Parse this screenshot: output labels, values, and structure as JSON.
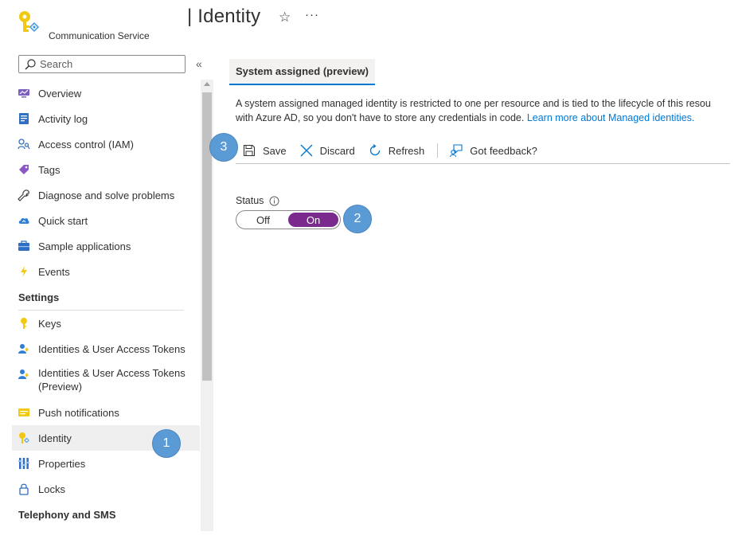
{
  "header": {
    "resource_type": "Communication Service",
    "title": "| Identity",
    "favorite_glyph": "☆",
    "more_glyph": "···"
  },
  "sidebar": {
    "search_placeholder": "Search",
    "collapse_glyph": "«",
    "items": [
      {
        "label": "Overview",
        "icon": "overview-icon"
      },
      {
        "label": "Activity log",
        "icon": "activity-log-icon"
      },
      {
        "label": "Access control (IAM)",
        "icon": "access-control-icon"
      },
      {
        "label": "Tags",
        "icon": "tag-icon"
      },
      {
        "label": "Diagnose and solve problems",
        "icon": "wrench-icon"
      },
      {
        "label": "Quick start",
        "icon": "cloud-icon"
      },
      {
        "label": "Sample applications",
        "icon": "briefcase-icon"
      },
      {
        "label": "Events",
        "icon": "lightning-icon"
      }
    ],
    "settings_heading": "Settings",
    "settings_items": [
      {
        "label": "Keys",
        "icon": "key-icon"
      },
      {
        "label": "Identities & User Access Tokens",
        "icon": "identities-icon"
      },
      {
        "label": "Identities & User Access Tokens (Preview)",
        "icon": "identities-icon"
      },
      {
        "label": "Push notifications",
        "icon": "push-notifications-icon"
      },
      {
        "label": "Identity",
        "icon": "identity-icon"
      },
      {
        "label": "Properties",
        "icon": "properties-icon"
      },
      {
        "label": "Locks",
        "icon": "lock-icon"
      }
    ],
    "telephony_heading": "Telephony and SMS"
  },
  "main": {
    "tab_label": "System assigned (preview)",
    "description_text": "A system assigned managed identity is restricted to one per resource and is tied to the lifecycle of this resource. You can grant permissions to the managed identity by using Azure role-based access control (Azure RBAC). The managed identity is authenticated with Azure AD, so you don't have to store any credentials in code.",
    "description_line1": "A system assigned managed identity is restricted to one per resource and is tied to the lifecycle of this resou",
    "description_line2": "with Azure AD, so you don't have to store any credentials in code.",
    "learn_more_link": "Learn more about Managed identities.",
    "toolbar": {
      "save": "Save",
      "discard": "Discard",
      "refresh": "Refresh",
      "feedback": "Got feedback?"
    },
    "status_label": "Status",
    "toggle": {
      "off": "Off",
      "on": "On",
      "selected": "On"
    }
  },
  "callouts": {
    "one": "1",
    "two": "2",
    "three": "3"
  },
  "colors": {
    "accent": "#0078d4",
    "toggle_on": "#7a2a8c",
    "callout": "#5b9bd5"
  }
}
